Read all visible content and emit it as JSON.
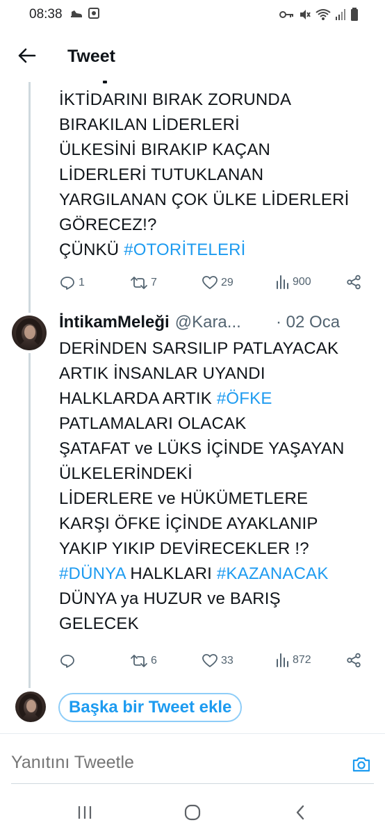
{
  "status_bar": {
    "time": "08:38",
    "icons_left": [
      "shoe-icon",
      "image-square-icon"
    ],
    "icons_right": [
      "key-icon",
      "mute-icon",
      "wifi-icon",
      "signal-icon",
      "battery-icon"
    ]
  },
  "header": {
    "back_icon": "arrow-left-icon",
    "title": "Tweet"
  },
  "tweet1": {
    "lines": [
      [
        {
          "text": "İKTİDARINI BIRAK ZORUNDA"
        }
      ],
      [
        {
          "text": "BIRAKILAN LİDERLERİ"
        }
      ],
      [
        {
          "text": "ÜLKESİNİ BIRAKIP KAÇAN"
        }
      ],
      [
        {
          "text": "LİDERLERİ TUTUKLANAN"
        }
      ],
      [
        {
          "text": "YARGILANAN ÇOK ÜLKE LİDERLERİ"
        }
      ],
      [
        {
          "text": "GÖRECEZ!?"
        }
      ],
      [
        {
          "text": "ÇÜNKÜ "
        },
        {
          "text": "#OTORİTELERİ",
          "hashtag": true
        }
      ]
    ],
    "actions": {
      "replies": "1",
      "retweets": "7",
      "likes": "29",
      "views": "900"
    }
  },
  "tweet2": {
    "display_name": "İntikamMeleği",
    "handle": "@Kara...",
    "date": "· 02 Oca",
    "lines": [
      [
        {
          "text": "DERİNDEN SARSILIP PATLAYACAK"
        }
      ],
      [
        {
          "text": "ARTIK İNSANLAR UYANDI"
        }
      ],
      [
        {
          "text": "HALKLARDA ARTIK "
        },
        {
          "text": "#ÖFKE",
          "hashtag": true
        }
      ],
      [
        {
          "text": "PATLAMALARI OLACAK"
        }
      ],
      [
        {
          "text": "ŞATAFAT ve LÜKS İÇİNDE YAŞAYAN"
        }
      ],
      [
        {
          "text": "ÜLKELERİNDEKİ"
        }
      ],
      [
        {
          "text": "LİDERLERE ve HÜKÜMETLERE"
        }
      ],
      [
        {
          "text": "KARŞI ÖFKE İÇİNDE AYAKLANIP"
        }
      ],
      [
        {
          "text": "YAKIP YIKIP DEVİRECEKLER !?"
        }
      ],
      [
        {
          "text": "#DÜNYA",
          "hashtag": true
        },
        {
          "text": " HALKLARI "
        },
        {
          "text": "#KAZANACAK",
          "hashtag": true
        }
      ],
      [
        {
          "text": "DÜNYA ya HUZUR ve BARIŞ"
        }
      ],
      [
        {
          "text": "GELECEK"
        }
      ]
    ],
    "actions": {
      "replies": "",
      "retweets": "6",
      "likes": "33",
      "views": "872"
    }
  },
  "add_tweet": {
    "label": "Başka bir Tweet ekle"
  },
  "reply_bar": {
    "placeholder": "Yanıtını Tweetle"
  },
  "colors": {
    "accent": "#1d9bf0",
    "text": "#0f1419",
    "muted": "#536471",
    "thread_line": "#cfd9de"
  }
}
